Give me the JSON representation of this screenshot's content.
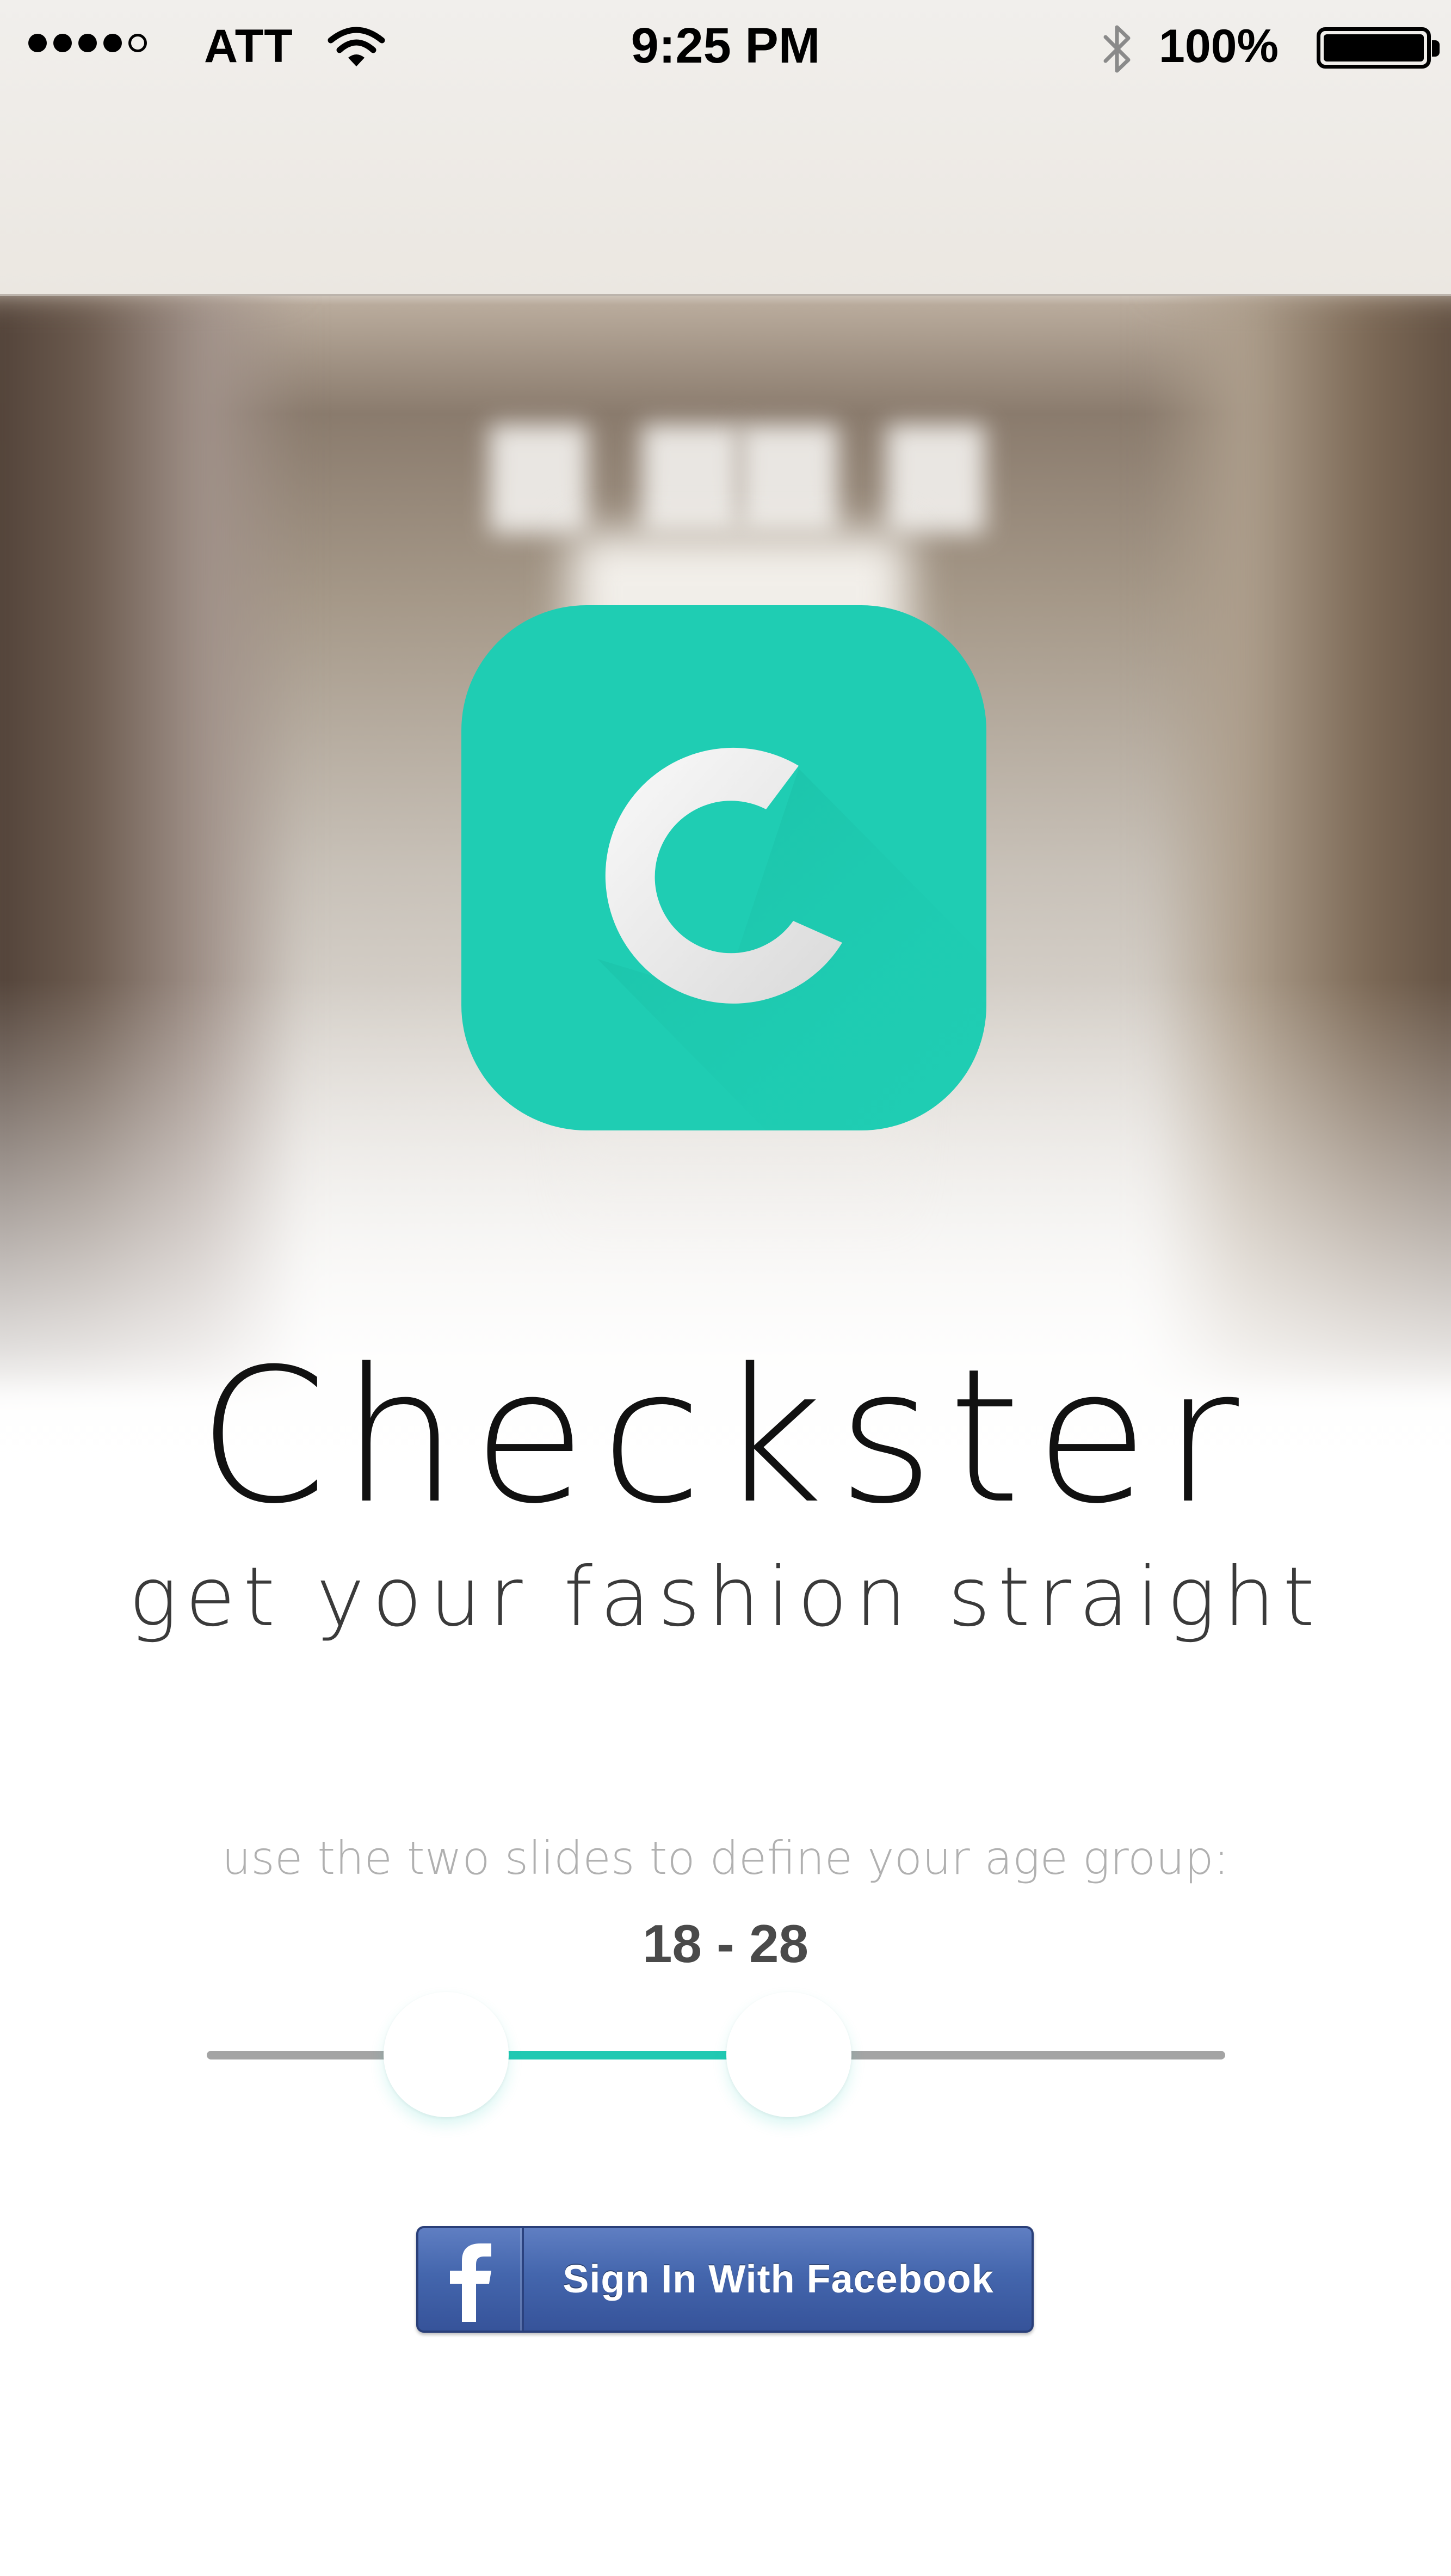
{
  "status_bar": {
    "carrier": "ATT",
    "time": "9:25 PM",
    "battery_percent": "100%",
    "signal_bars_filled": 4,
    "signal_bars_total": 5,
    "icons": [
      "signal-icon",
      "wifi-icon",
      "bluetooth-icon",
      "battery-icon"
    ]
  },
  "app": {
    "name": "Checkster",
    "tagline": "get your fashion straight",
    "icon_letter_icon": "c-logo-icon",
    "brand_color": "#1fcdb3"
  },
  "age_selector": {
    "instruction": "use the two slides to define your age group:",
    "range_label": "18 - 28",
    "min_value": 18,
    "max_value": 28,
    "accent_color": "#20c9b2",
    "track_color": "#a4a4a4"
  },
  "facebook": {
    "button_label": "Sign In With Facebook",
    "icon": "facebook-f-icon",
    "button_color": "#4466ad"
  }
}
